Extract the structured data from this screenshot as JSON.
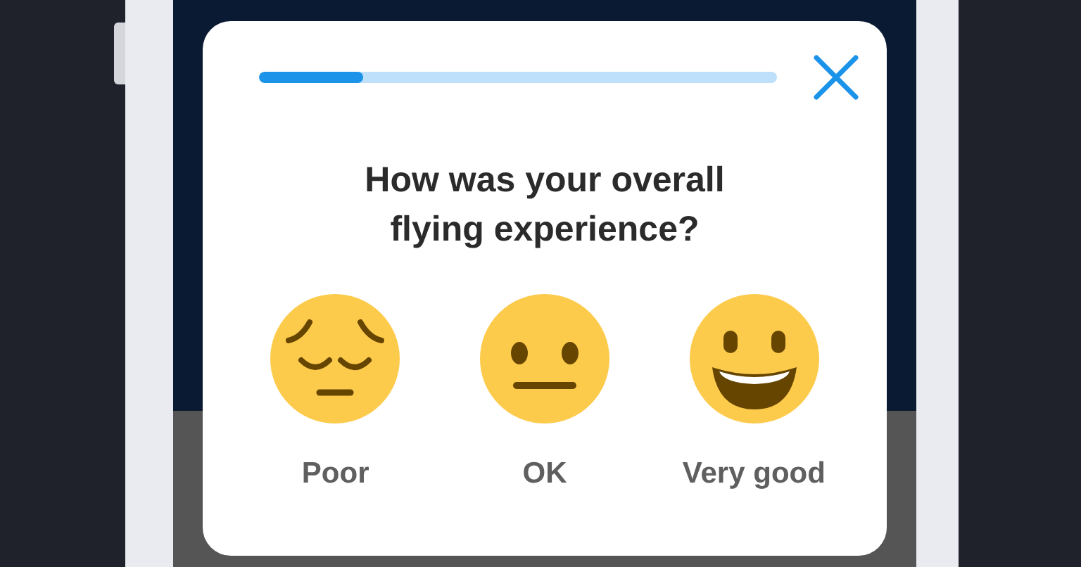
{
  "progress": {
    "level": 0.2
  },
  "question": "How was your overall flying experience?",
  "options": [
    {
      "kind": "sad",
      "label": "Poor"
    },
    {
      "kind": "neutral",
      "label": "OK"
    },
    {
      "kind": "happy",
      "label": "Very good"
    }
  ]
}
